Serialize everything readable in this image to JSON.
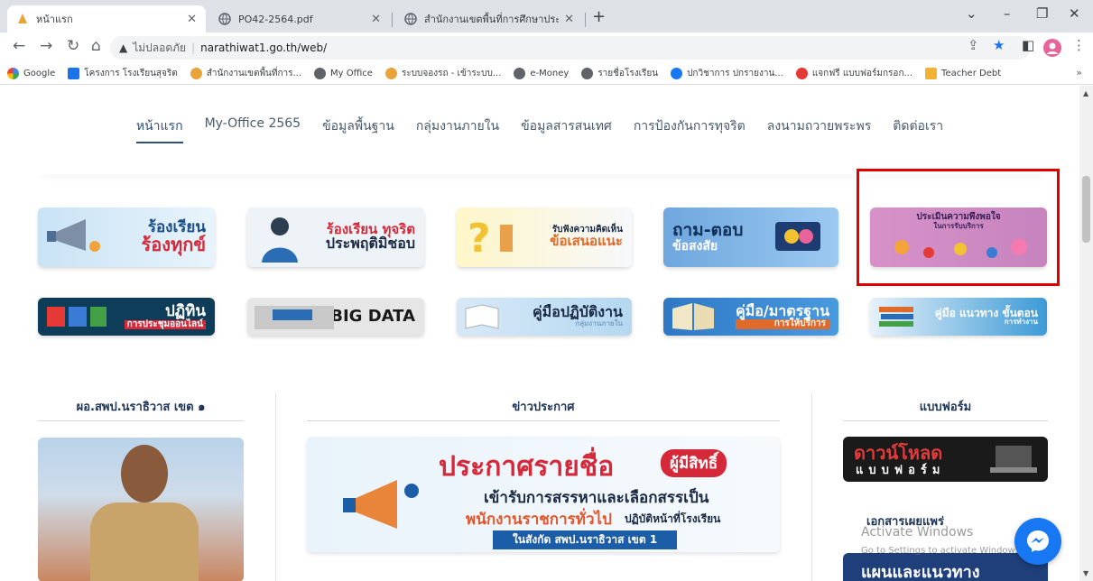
{
  "browser": {
    "tabs": [
      {
        "title": "หน้าแรก",
        "active": true,
        "icon": "school-logo-icon"
      },
      {
        "title": "PO42-2564.pdf",
        "active": false,
        "icon": "globe-icon"
      },
      {
        "title": "สำนักงานเขตพื้นที่การศึกษาประถมศึก",
        "active": false,
        "icon": "globe-icon"
      }
    ],
    "new_tab": "+",
    "security": "ไม่ปลอดภัย",
    "url": "narathiwat1.go.th/web/",
    "bookmarks": [
      {
        "label": "Google",
        "icon": "google-icon"
      },
      {
        "label": "โครงการ โรงเรียนสุจริต",
        "icon": "table-icon"
      },
      {
        "label": "สำนักงานเขตพื้นที่การ...",
        "icon": "school-logo-icon"
      },
      {
        "label": "My Office",
        "icon": "globe-icon"
      },
      {
        "label": "ระบบจองรถ - เข้าระบบ...",
        "icon": "school-logo-icon"
      },
      {
        "label": "e-Money",
        "icon": "globe-icon"
      },
      {
        "label": "รายชื่อโรงเรียน",
        "icon": "globe-icon"
      },
      {
        "label": "ปกวิชาการ ปกรายงาน...",
        "icon": "facebook-icon"
      },
      {
        "label": "แจกฟรี แบบฟอร์มกรอก...",
        "icon": "red-circle-icon"
      },
      {
        "label": "Teacher Debt",
        "icon": "folder-icon"
      }
    ],
    "bookmarks_more": "»"
  },
  "site": {
    "nav": [
      {
        "label": "หน้าแรก",
        "active": true
      },
      {
        "label": "My-Office 2565",
        "active": false
      },
      {
        "label": "ข้อมูลพื้นฐาน",
        "active": false
      },
      {
        "label": "กลุ่มงานภายใน",
        "active": false
      },
      {
        "label": "ข้อมูลสารสนเทศ",
        "active": false
      },
      {
        "label": "การป้องกันการทุจริต",
        "active": false
      },
      {
        "label": "ลงนามถวายพระพร",
        "active": false
      },
      {
        "label": "ติดต่อเรา",
        "active": false
      }
    ],
    "banners_row1": [
      {
        "line1": "ร้องเรียน",
        "line2": "ร้องทุกข์"
      },
      {
        "line1": "ร้องเรียน ทุจริต",
        "line2": "ประพฤติมิชอบ"
      },
      {
        "line1": "รับฟังความคิดเห็น",
        "line2": "ข้อเสนอแนะ"
      },
      {
        "line1": "ถาม-ตอบ",
        "line2": "ข้อสงสัย"
      },
      {
        "line1": "ประเมินความพึงพอใจ",
        "line2": "ในการรับบริการ"
      }
    ],
    "banners_row2": [
      {
        "line1": "ปฏิทิน",
        "line2": "การประชุมออนไลน์"
      },
      {
        "line1": "BIG DATA",
        "line2": ""
      },
      {
        "line1": "คู่มือปฏิบัติงาน",
        "line2": "กลุ่มงานภายใน"
      },
      {
        "line1": "คู่มือ/มาตรฐาน",
        "line2": "การให้บริการ"
      },
      {
        "line1": "คู่มือ แนวทาง ขั้นตอน",
        "line2": "การทำงาน"
      }
    ],
    "col_left_title": "ผอ.สพป.นราธิวาส เขต ๑",
    "col_mid_title": "ข่าวประกาศ",
    "col_right_title": "แบบฟอร์ม",
    "news": {
      "headline": "ประกาศรายชื่อ",
      "pill": "ผู้มีสิทธิ์",
      "line2": "เข้ารับการสรรหาและเลือกสรรเป็น",
      "line3a": "พนักงานราชการทั่วไป",
      "line3b": "ปฏิบัติหน้าที่โรงเรียน",
      "line4": "ในสังกัด สพป.นราธิวาส เขต 1"
    },
    "form_button": {
      "line1": "ดาวน์โหลด",
      "line2": "แบบฟอร์ม"
    },
    "docs_title": "เอกสารเผยแพร่",
    "plan_banner": "แผนและแนวทาง",
    "watermark": {
      "line1": "Activate Windows",
      "line2": "Go to Settings to activate Windows."
    }
  }
}
